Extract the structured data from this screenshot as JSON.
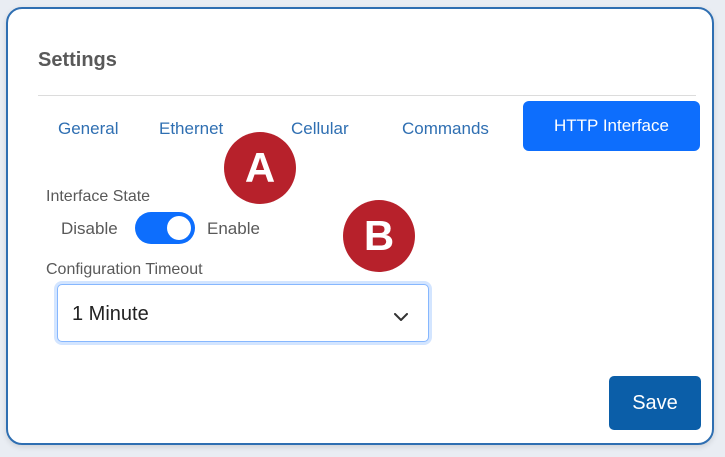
{
  "panel": {
    "title": "Settings"
  },
  "tabs": [
    {
      "label": "General"
    },
    {
      "label": "Ethernet"
    },
    {
      "label": "Cellular"
    },
    {
      "label": "Commands"
    },
    {
      "label": "HTTP Interface",
      "active": true
    }
  ],
  "callouts": {
    "a": "A",
    "b": "B"
  },
  "interface_state": {
    "label": "Interface State",
    "off_label": "Disable",
    "on_label": "Enable",
    "enabled": true
  },
  "config_timeout": {
    "label": "Configuration Timeout",
    "value": "1 Minute"
  },
  "actions": {
    "save_label": "Save"
  },
  "colors": {
    "accent": "#0d6efd",
    "save": "#0b5ea8",
    "callout": "#b7212b",
    "border": "#2f6fb2"
  }
}
